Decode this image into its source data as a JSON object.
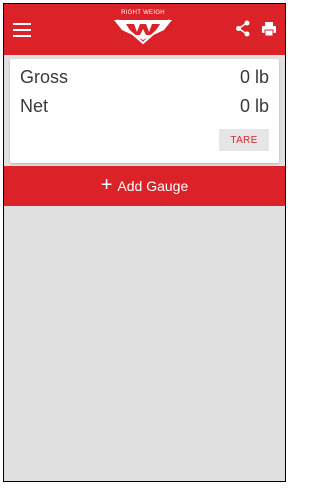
{
  "header": {
    "brand_text": "RIGHT WEIGH",
    "menu_icon": "menu-icon",
    "share_icon": "share-icon",
    "print_icon": "print-icon",
    "accent_color": "#da2228"
  },
  "weights": {
    "gross_label": "Gross",
    "gross_value": "0 lb",
    "net_label": "Net",
    "net_value": "0 lb",
    "tare_label": "TARE"
  },
  "actions": {
    "add_gauge_plus": "+",
    "add_gauge_label": "Add Gauge"
  }
}
